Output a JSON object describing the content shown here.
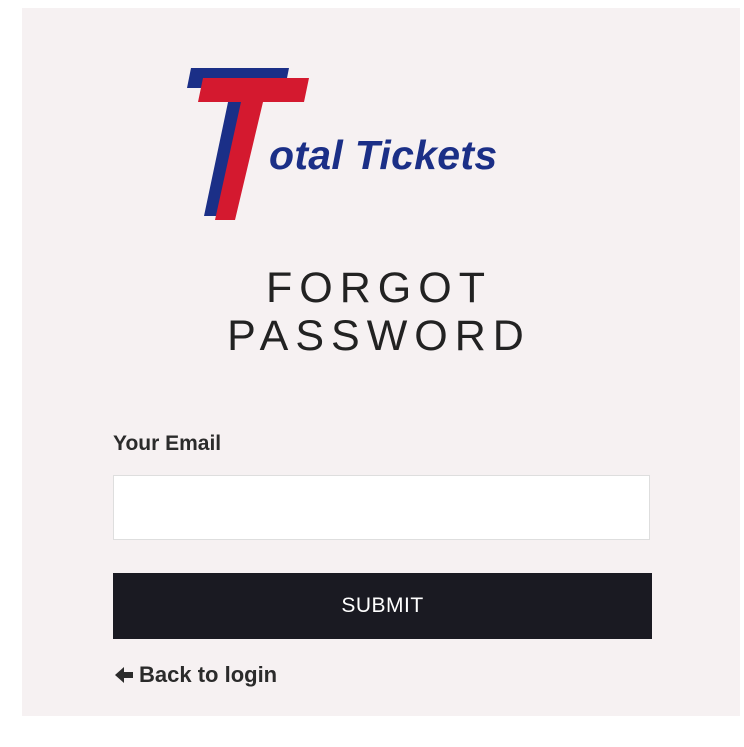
{
  "logo": {
    "text": "otal Tickets",
    "colors": {
      "red": "#d4192f",
      "blue": "#1b2f87"
    }
  },
  "title": {
    "line1": "FORGOT",
    "line2": "PASSWORD"
  },
  "form": {
    "email_label": "Your Email",
    "email_value": "",
    "submit_label": "SUBMIT"
  },
  "back_link": {
    "icon": "arrow-left-icon",
    "label": "Back to login"
  },
  "colors": {
    "panel_background": "#f6f1f2",
    "button_background": "#1a1a22",
    "button_text": "#ffffff"
  }
}
